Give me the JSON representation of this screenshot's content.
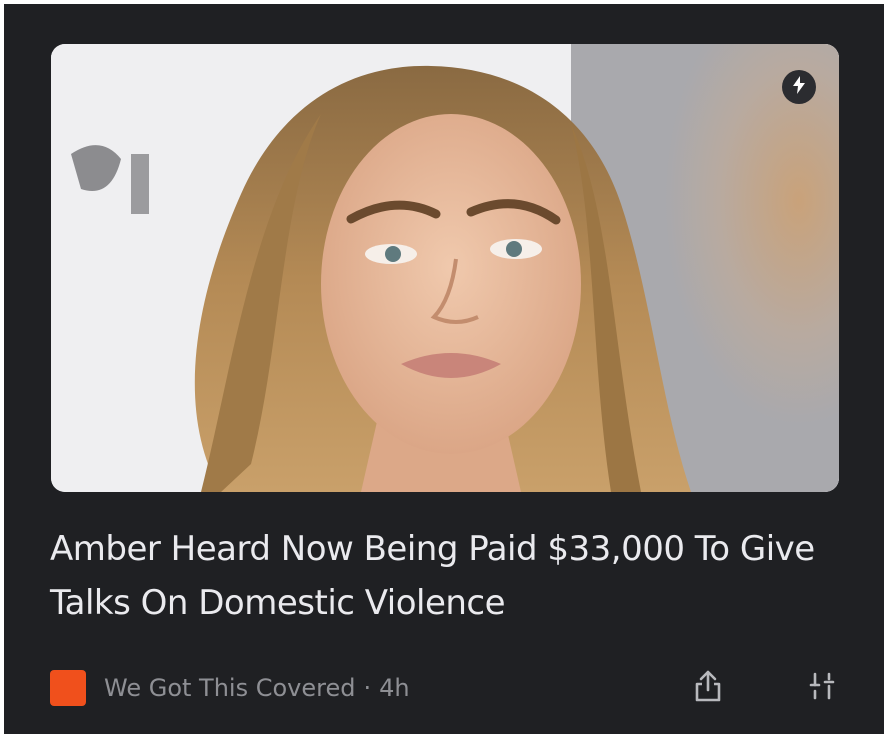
{
  "article": {
    "headline": "Amber Heard Now Being Paid $33,000 To Give Talks On Domestic Violence",
    "source": "We Got This Covered",
    "separator": "·",
    "age": "4h",
    "image_icon": "flash-icon",
    "source_logo_color": "#f0501c"
  },
  "actions": {
    "share_icon": "share-icon",
    "more_icon": "tune-icon"
  },
  "colors": {
    "card_bg": "#1f2023",
    "headline": "#eaeaee",
    "meta": "#8e8f94"
  }
}
